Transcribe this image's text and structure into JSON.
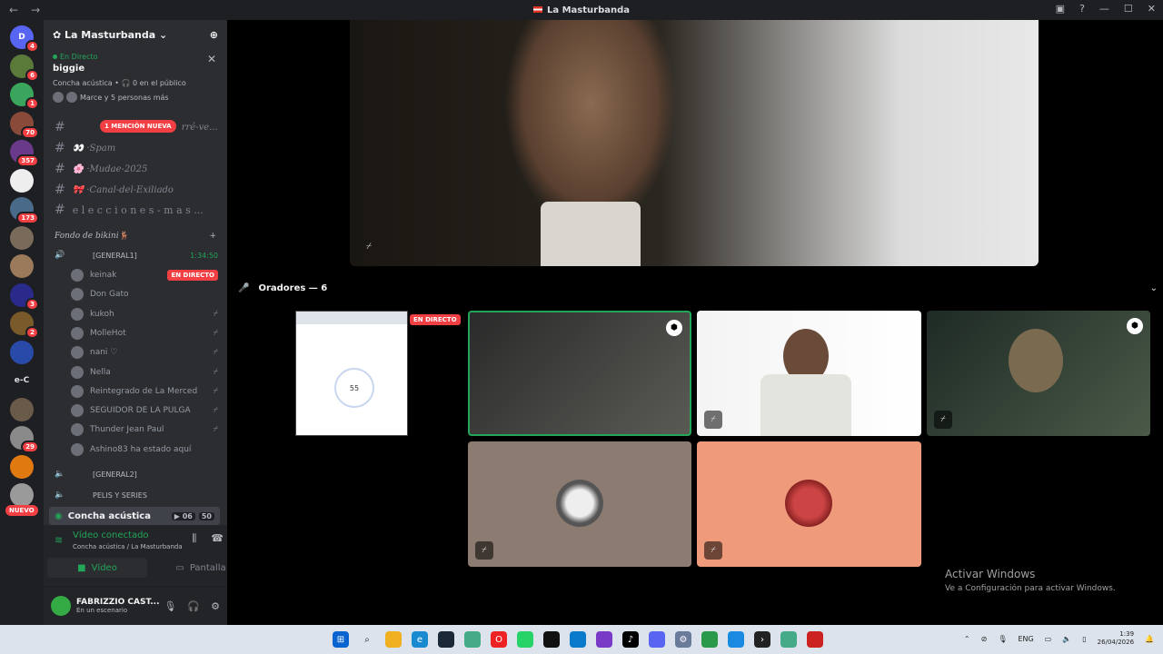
{
  "window": {
    "title": "La Masturbanda"
  },
  "servers": [
    {
      "label": "D",
      "badge": "4",
      "color": "#5865f2"
    },
    {
      "label": "",
      "badge": "6",
      "color": "#5a7a3a"
    },
    {
      "label": "",
      "badge": "1",
      "color": "#3ba55d"
    },
    {
      "label": "",
      "badge": "70",
      "color": "#8a4a3a"
    },
    {
      "label": "",
      "badge": "357",
      "color": "#6a3a8a"
    },
    {
      "label": "",
      "badge": "",
      "color": "#eeeeee"
    },
    {
      "label": "",
      "badge": "173",
      "color": "#4a6a8a"
    },
    {
      "label": "",
      "badge": "",
      "color": "#7a6a5a"
    },
    {
      "label": "",
      "badge": "",
      "color": "#9a7a5a"
    },
    {
      "label": "",
      "badge": "3",
      "color": "#2a2a8a"
    },
    {
      "label": "",
      "badge": "2",
      "color": "#7a5a2a"
    },
    {
      "label": "",
      "badge": "",
      "color": "#2a4aaa"
    },
    {
      "label": "e-C",
      "badge": "",
      "color": "#1e1f22"
    },
    {
      "label": "",
      "badge": "",
      "color": "#6a5a4a"
    },
    {
      "label": "",
      "badge": "29",
      "color": "#8a8a8a"
    },
    {
      "label": "",
      "badge": "",
      "color": "#e07a10"
    },
    {
      "label": "",
      "badge": "",
      "color": "#9a9a9a"
    }
  ],
  "nuevo": "NUEVO",
  "guild": {
    "name": "La Masturbanda"
  },
  "live": {
    "label": "En Directo",
    "name": "biggie",
    "meta": "Concha acústica • 🎧 0 en el público",
    "people": "Marce y 5 personas más"
  },
  "mention": "1 MENCIÓN NUEVA",
  "channels": [
    "rré-ve...",
    "Spam",
    "Mudae-2025",
    "Canal-del-Exiliado",
    "e l e c c i o n e s - m a s ..."
  ],
  "category": "Fondo de bikini🦌",
  "voice": {
    "name": "[GENERAL1]",
    "time": "1:34:50"
  },
  "members": [
    {
      "name": "keinak",
      "state": "live"
    },
    {
      "name": "Don Gato",
      "state": ""
    },
    {
      "name": "kukoh",
      "state": "muted"
    },
    {
      "name": "MolleHot",
      "state": "muted"
    },
    {
      "name": "nani ♡",
      "state": "muted"
    },
    {
      "name": "Nella",
      "state": "muted"
    },
    {
      "name": "Reintegrado de La Merced",
      "state": "deaf"
    },
    {
      "name": "SEGUIDOR DE LA PULGA",
      "state": "muted"
    },
    {
      "name": "Thunder Jean Paul",
      "state": "muted"
    },
    {
      "name": "Ashino83 ha estado aquí",
      "state": ""
    }
  ],
  "live_badge": "EN DIRECTO",
  "voice2": "[GENERAL2]",
  "voice3": "PELIS Y SERIES",
  "stage": {
    "name": "Concha acústica",
    "video_count": "06",
    "count": "50"
  },
  "connection": {
    "status": "Vídeo conectado",
    "sub": "Concha acústica / La Masturbanda",
    "video_btn": "Vídeo",
    "screen_btn": "Pantalla"
  },
  "user": {
    "name": "FABRIZZIO CAST...",
    "status": "En un escenario"
  },
  "speakers": {
    "label": "Oradores — 6"
  },
  "screen_share": {
    "number": "55"
  },
  "watermark": {
    "line1": "Activar Windows",
    "line2": "Ve a Configuración para activar Windows."
  },
  "tray": {
    "lang": "ENG",
    "time": "1:39",
    "date": "26/04/2026"
  },
  "colors": {
    "bg": "#2b2d31",
    "accent": "#23a55a",
    "danger": "#f23f43",
    "blurple": "#5865f2"
  }
}
